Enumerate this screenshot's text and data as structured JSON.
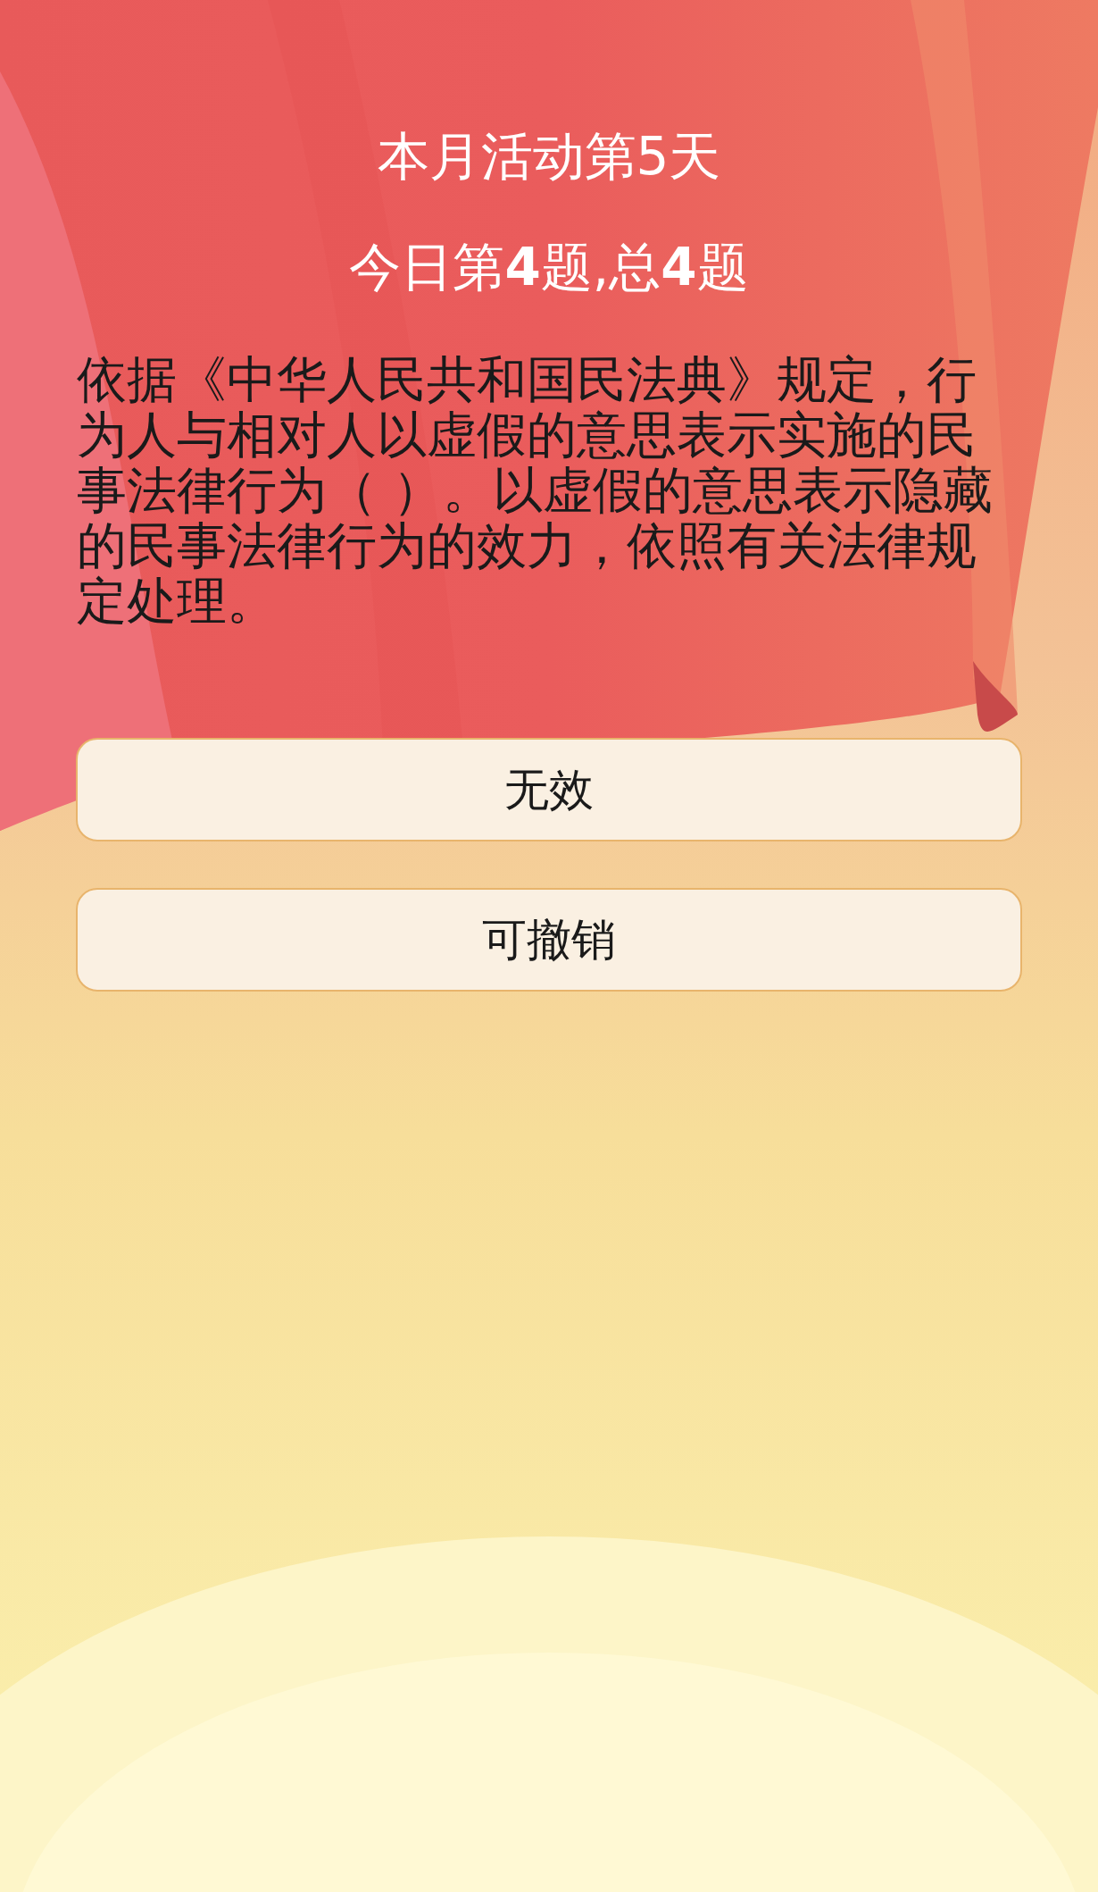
{
  "header": {
    "title": "本月活动第5天",
    "progress": "今日第**4**题,总**4**题"
  },
  "question": {
    "text": "依据《中华人民共和国民法典》规定，行为人与相对人以虚假的意思表示实施的民事法律行为（ ）。以虚假的意思表示隐藏的民事法律行为的效力，依照有关法律规定处理。"
  },
  "options": [
    {
      "label": "无效"
    },
    {
      "label": "可撤销"
    }
  ]
}
